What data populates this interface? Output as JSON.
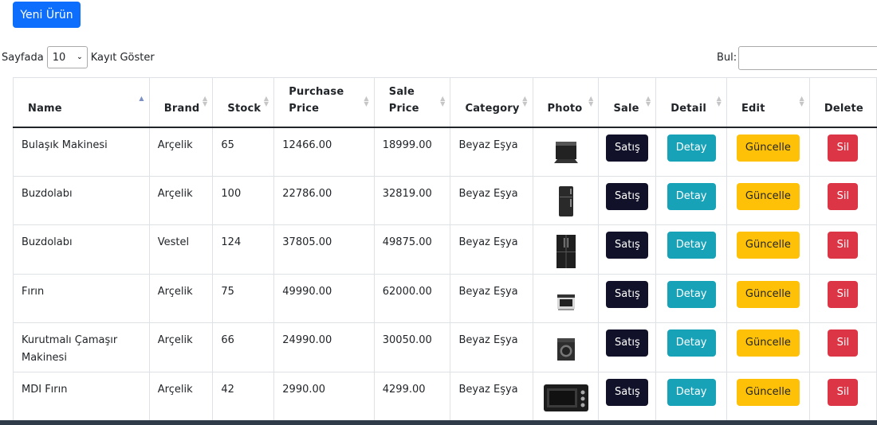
{
  "toolbar": {
    "new_button": "Yeni Ürün"
  },
  "length_control": {
    "prefix": "Sayfada",
    "value": "10",
    "suffix": "Kayıt Göster"
  },
  "search": {
    "label": "Bul:",
    "value": ""
  },
  "table": {
    "headers": {
      "name": "Name",
      "brand": "Brand",
      "stock": "Stock",
      "purchase_1": "Purchase",
      "purchase_2": "Price",
      "sale_1": "Sale",
      "sale_2": "Price",
      "category": "Category",
      "photo": "Photo",
      "sale": "Sale",
      "detail": "Detail",
      "edit": "Edit",
      "delete": "Delete"
    },
    "rows": [
      {
        "name": "Bulaşık Makinesi",
        "brand": "Arçelik",
        "stock": "65",
        "purchase": "12466.00",
        "sale": "18999.00",
        "category": "Beyaz Eşya",
        "photo_icon": "dishwasher-icon"
      },
      {
        "name": "Buzdolabı",
        "brand": "Arçelik",
        "stock": "100",
        "purchase": "22786.00",
        "sale": "32819.00",
        "category": "Beyaz Eşya",
        "photo_icon": "fridge-icon"
      },
      {
        "name": "Buzdolabı",
        "brand": "Vestel",
        "stock": "124",
        "purchase": "37805.00",
        "sale": "49875.00",
        "category": "Beyaz Eşya",
        "photo_icon": "double-fridge-icon"
      },
      {
        "name": "Fırın",
        "brand": "Arçelik",
        "stock": "75",
        "purchase": "49990.00",
        "sale": "62000.00",
        "category": "Beyaz Eşya",
        "photo_icon": "oven-icon"
      },
      {
        "name": "Kurutmalı Çamaşır Makinesi",
        "brand": "Arçelik",
        "stock": "66",
        "purchase": "24990.00",
        "sale": "30050.00",
        "category": "Beyaz Eşya",
        "photo_icon": "washer-icon"
      },
      {
        "name": "MDI Fırın",
        "brand": "Arçelik",
        "stock": "42",
        "purchase": "2990.00",
        "sale": "4299.00",
        "category": "Beyaz Eşya",
        "photo_icon": "mini-oven-icon"
      }
    ],
    "actions": {
      "sale": "Satış",
      "detail": "Detay",
      "edit": "Güncelle",
      "delete": "Sil"
    }
  },
  "colors": {
    "primary": "#0d6efd",
    "sale_button": "#111129",
    "detail_button": "#17a2b8",
    "edit_button": "#ffc107",
    "delete_button": "#dc3545",
    "footer": "#2f3b49"
  }
}
